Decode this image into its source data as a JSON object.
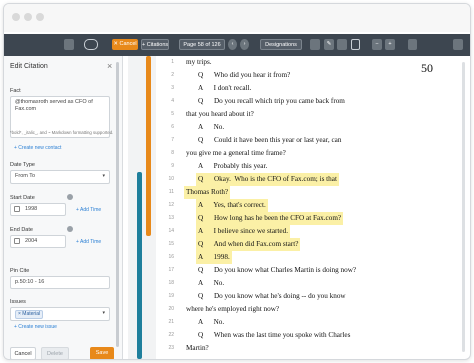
{
  "toolbar": {
    "cancel_label": "✕ Cancel",
    "citations_label": "+ Citations",
    "page_label": "Page 58 of 126",
    "designations_label": "Designations"
  },
  "sidebar": {
    "title": "Edit Citation",
    "fact_label": "Fact",
    "fact_value": "@thomasroth served as CFO of Fax.com",
    "create_contact": "+ Create new contact",
    "help_text": "*bold*, _italic_, and ~ Markdown formatting supported.",
    "date_type_label": "Date Type",
    "date_type_value": "From To",
    "start_date_label": "Start Date",
    "start_date_value": "1998",
    "end_date_label": "End Date",
    "end_date_value": "2004",
    "add_time": "+ Add Time",
    "pin_cite_label": "Pin Cite",
    "pin_cite_value": "p.50:10 - 16",
    "issues_label": "Issues",
    "issue_tag": "× Material",
    "create_issue": "+ Create new issue",
    "cancel_button": "Cancel",
    "delete_button": "Delete",
    "save_button": "Save"
  },
  "transcript": {
    "page_number": "50",
    "lines": [
      {
        "n": "1",
        "indent": 0,
        "text": "my trips.",
        "hl": false
      },
      {
        "n": "2",
        "indent": 1,
        "text": "Q      Who did you hear it from?",
        "hl": false
      },
      {
        "n": "3",
        "indent": 1,
        "text": "A      I don't recall.",
        "hl": false
      },
      {
        "n": "4",
        "indent": 1,
        "text": "Q      Do you recall which trip you came back from",
        "hl": false
      },
      {
        "n": "5",
        "indent": 0,
        "text": "that you heard about it?",
        "hl": false
      },
      {
        "n": "6",
        "indent": 1,
        "text": "A      No.",
        "hl": false
      },
      {
        "n": "7",
        "indent": 1,
        "text": "Q      Could it have been this year or last year, can",
        "hl": false
      },
      {
        "n": "8",
        "indent": 0,
        "text": "you give me a general time frame?",
        "hl": false
      },
      {
        "n": "9",
        "indent": 1,
        "text": "A      Probably this year.",
        "hl": false
      },
      {
        "n": "10",
        "indent": 1,
        "text": "Q      Okay.  Who is the CFO of Fax.com; is that",
        "hl": true
      },
      {
        "n": "11",
        "indent": 0,
        "text": "Thomas Roth?",
        "hl": true
      },
      {
        "n": "12",
        "indent": 1,
        "text": "A      Yes, that's correct.",
        "hl": true
      },
      {
        "n": "13",
        "indent": 1,
        "text": "Q      How long has he been the CFO at Fax.com?",
        "hl": true
      },
      {
        "n": "14",
        "indent": 1,
        "text": "A      I believe since we started.",
        "hl": true
      },
      {
        "n": "15",
        "indent": 1,
        "text": "Q      And when did Fax.com start?",
        "hl": true
      },
      {
        "n": "16",
        "indent": 1,
        "text": "A      1998.",
        "hl": true
      },
      {
        "n": "17",
        "indent": 1,
        "text": "Q      Do you know what Charles Martin is doing now?",
        "hl": false
      },
      {
        "n": "18",
        "indent": 1,
        "text": "A      No.",
        "hl": false
      },
      {
        "n": "19",
        "indent": 1,
        "text": "Q      Do you know what he's doing -- do you know",
        "hl": false
      },
      {
        "n": "20",
        "indent": 0,
        "text": "where he's employed right now?",
        "hl": false
      },
      {
        "n": "21",
        "indent": 1,
        "text": "A      No.",
        "hl": false
      },
      {
        "n": "22",
        "indent": 1,
        "text": "Q      When was the last time you spoke with Charles",
        "hl": false
      },
      {
        "n": "23",
        "indent": 0,
        "text": "Martin?",
        "hl": false
      }
    ]
  },
  "colors": {
    "toolbar_bg": "#3d4650",
    "accent_orange": "#e8891a",
    "highlight_yellow": "#fbf0a6",
    "teal_bar": "#1f7f9c",
    "link_blue": "#2a7fd4"
  }
}
